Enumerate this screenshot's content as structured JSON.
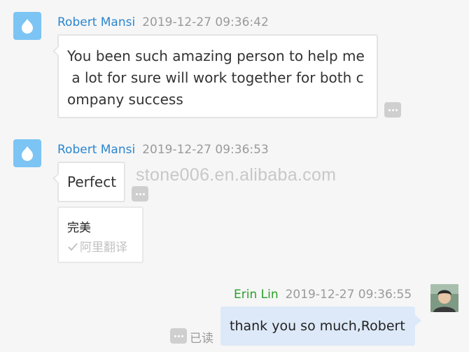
{
  "messages": [
    {
      "sender": "Robert Mansi",
      "time": "2019-12-27 09:36:42",
      "text": "You been such amazing person to help me\n a lot for sure will work together for both c\nompany success"
    },
    {
      "sender": "Robert Mansi",
      "time": "2019-12-27 09:36:53",
      "text": "Perfect",
      "translation": {
        "text": "完美",
        "source": "阿里翻译"
      }
    }
  ],
  "reply": {
    "sender": "Erin Lin",
    "time": "2019-12-27 09:36:55",
    "text": "thank you so much,Robert",
    "status": "已读"
  },
  "watermark": "stone006.en.alibaba.com",
  "colors": {
    "sender_name": "#2b86d0",
    "reply_name": "#2aa02a",
    "reply_bubble": "#dde9f8",
    "avatar_bot": "#7cc4f4"
  },
  "icons": {
    "sender_avatar": "chat-drop-icon",
    "more": "ellipsis-icon",
    "translate_done": "check-icon"
  }
}
